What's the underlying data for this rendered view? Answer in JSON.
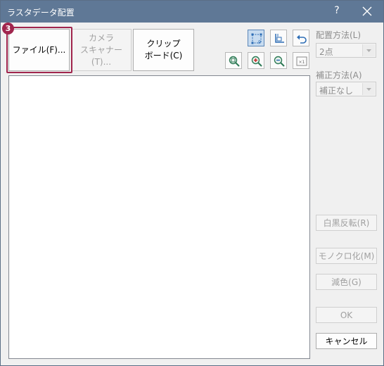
{
  "window": {
    "title": "ラスタデータ配置",
    "help_label": "?"
  },
  "buttons": {
    "file": "ファイル(F)...",
    "camera_scanner": "カメラ\nスキャナー(T)...",
    "clipboard": "クリップ\nボード(C)"
  },
  "step_badge": "3",
  "placement": {
    "label": "配置方法(L)",
    "value": "2点"
  },
  "correction": {
    "label": "補正方法(A)",
    "value": "補正なし"
  },
  "actions": {
    "invert": "白黒反転(R)",
    "monochrome": "モノクロ化(M)",
    "reduce_color": "減色(G)",
    "ok": "OK",
    "cancel": "キャンセル"
  },
  "icons": [
    "two-point-place-icon",
    "place-icon",
    "undo-icon",
    "zoom-fit-icon",
    "zoom-in-icon",
    "zoom-out-icon",
    "zoom-actual-icon"
  ],
  "colors": {
    "titlebar": "#5f7896",
    "highlight": "#a0254d",
    "active_tool": "#c8dcf0"
  }
}
